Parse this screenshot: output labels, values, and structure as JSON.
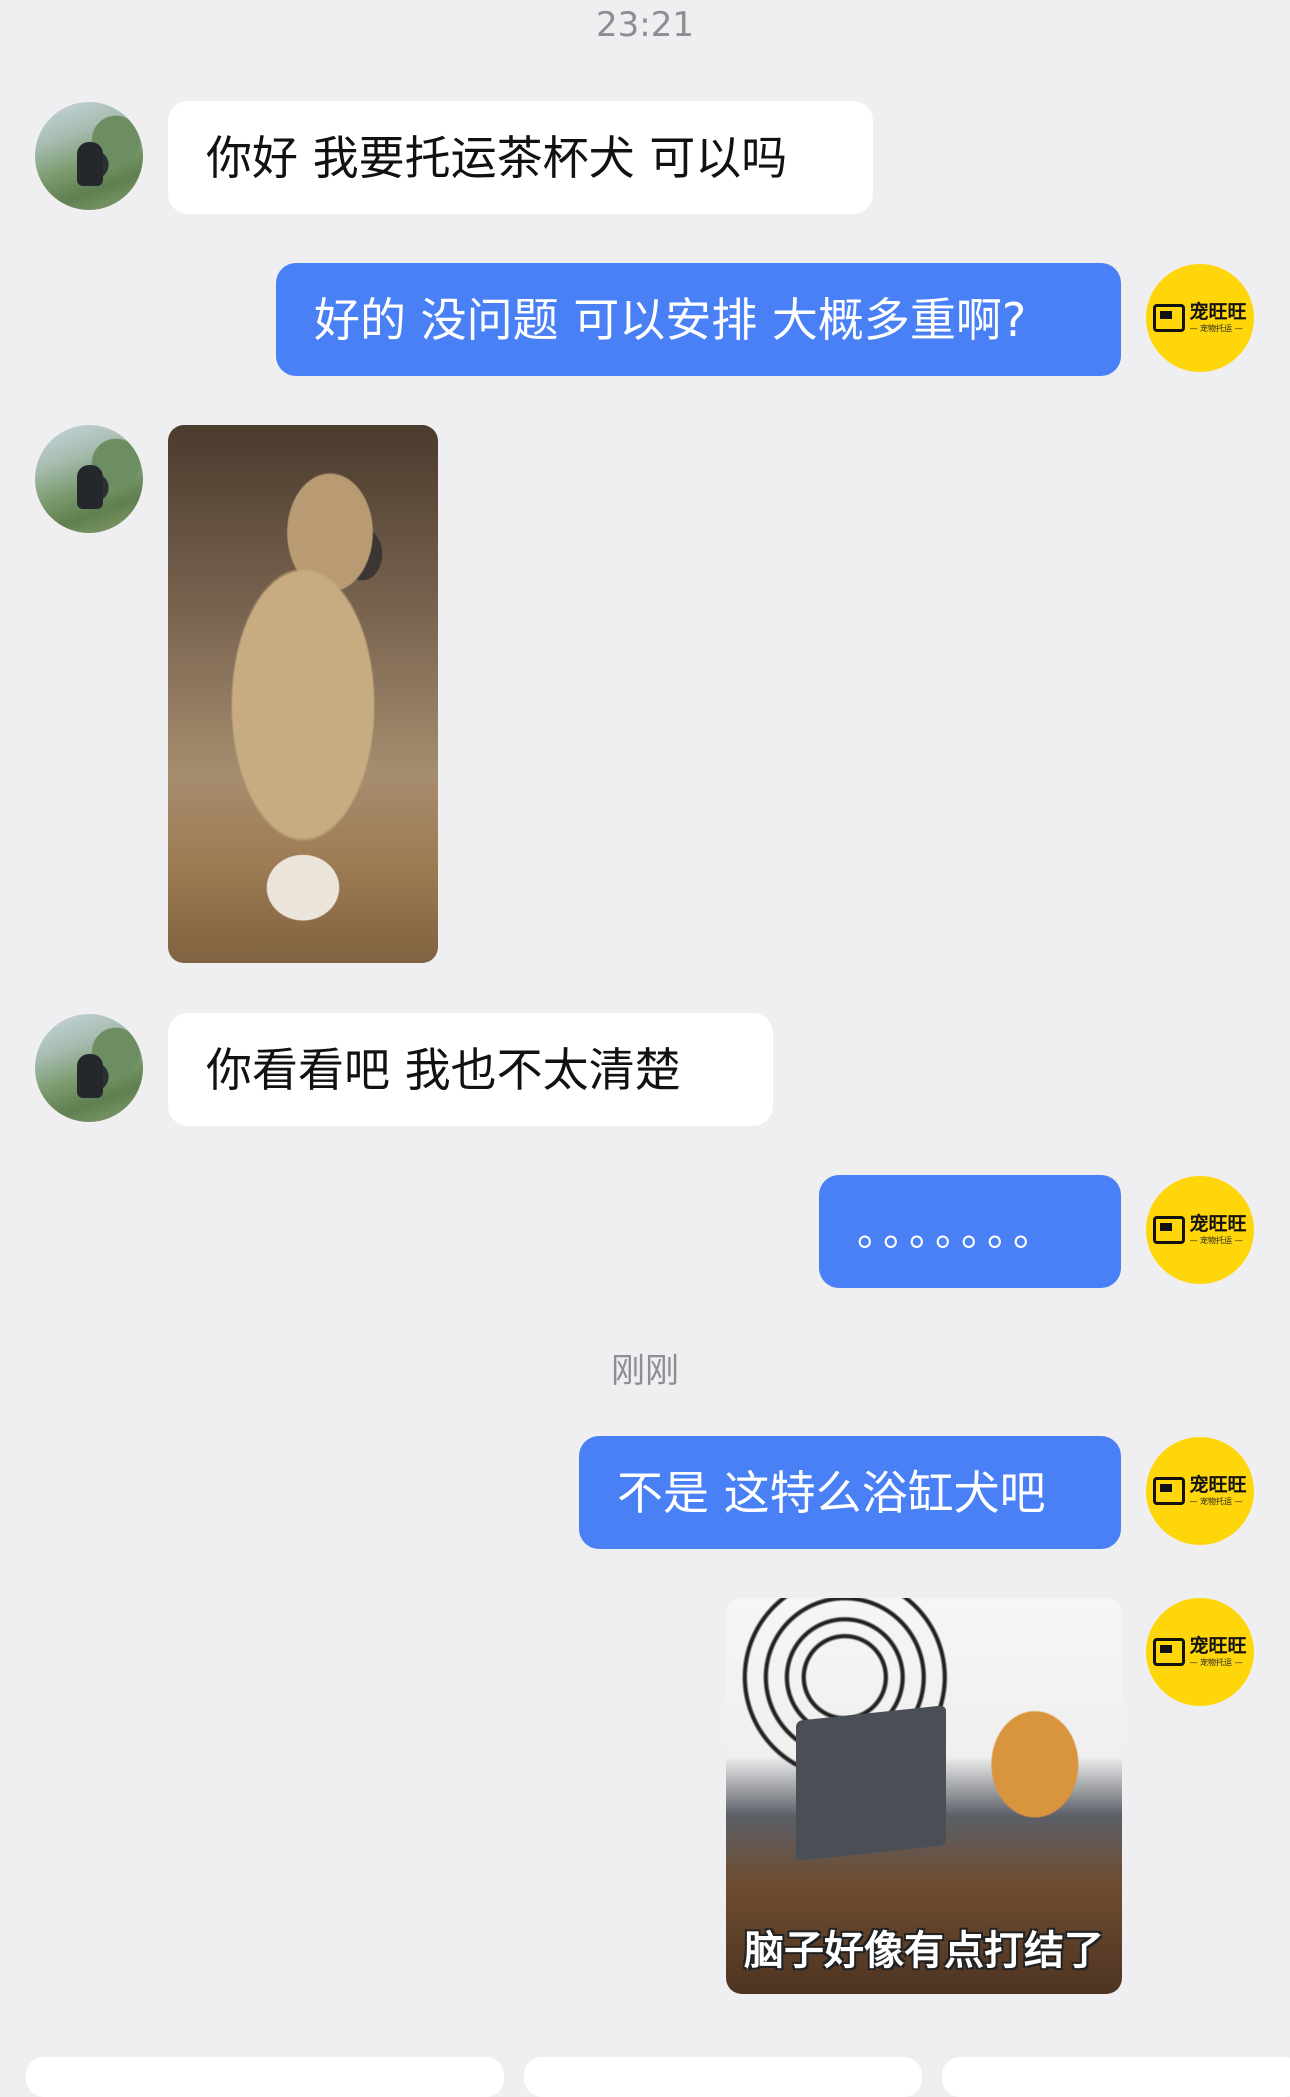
{
  "chat": {
    "timestamp_top": "23:21",
    "timestamp_recent": "刚刚",
    "messages": [
      {
        "side": "in",
        "type": "text",
        "text": "你好 我要托运茶杯犬 可以吗"
      },
      {
        "side": "out",
        "type": "text",
        "text": "好的 没问题 可以安排 大概多重啊?"
      },
      {
        "side": "in",
        "type": "image",
        "subject": "dog-in-teacup"
      },
      {
        "side": "in",
        "type": "text",
        "text": "你看看吧 我也不太清楚"
      },
      {
        "side": "out",
        "type": "text",
        "text": "。。。。。。。"
      },
      {
        "side": "out",
        "type": "text",
        "text": "不是 这特么浴缸犬吧"
      },
      {
        "side": "out",
        "type": "sticker",
        "caption": "脑子好像有点打结了"
      }
    ]
  },
  "brand": {
    "name": "宠旺旺",
    "tagline": "— 宠物托运 —",
    "color": "#ffd60a"
  },
  "colors": {
    "background": "#efeff1",
    "outgoing_bubble": "#4a80f5",
    "incoming_bubble": "#ffffff"
  }
}
